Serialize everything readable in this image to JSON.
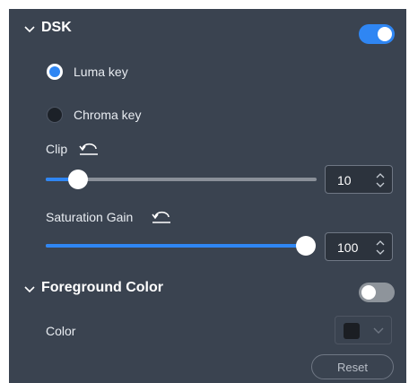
{
  "dsk": {
    "title": "DSK",
    "enabled": true,
    "key_options": [
      {
        "label": "Luma key",
        "selected": true
      },
      {
        "label": "Chroma key",
        "selected": false
      }
    ],
    "clip": {
      "label": "Clip",
      "value": "10",
      "fraction": 0.12
    },
    "saturation_gain": {
      "label": "Saturation Gain",
      "value": "100",
      "fraction": 1.0
    }
  },
  "foreground": {
    "title": "Foreground Color",
    "enabled": false,
    "color_label": "Color",
    "color_value": "#1b1e23",
    "reset_label": "Reset"
  },
  "colors": {
    "panel_bg": "#3a4350",
    "accent": "#2f86f3",
    "track": "#8a9099",
    "toggle_off": "#8e949b"
  },
  "icons": {
    "collapse": "chevron-down-icon",
    "reset": "undo-arrow-icon",
    "stepper": "up-down-chevron-icon"
  }
}
